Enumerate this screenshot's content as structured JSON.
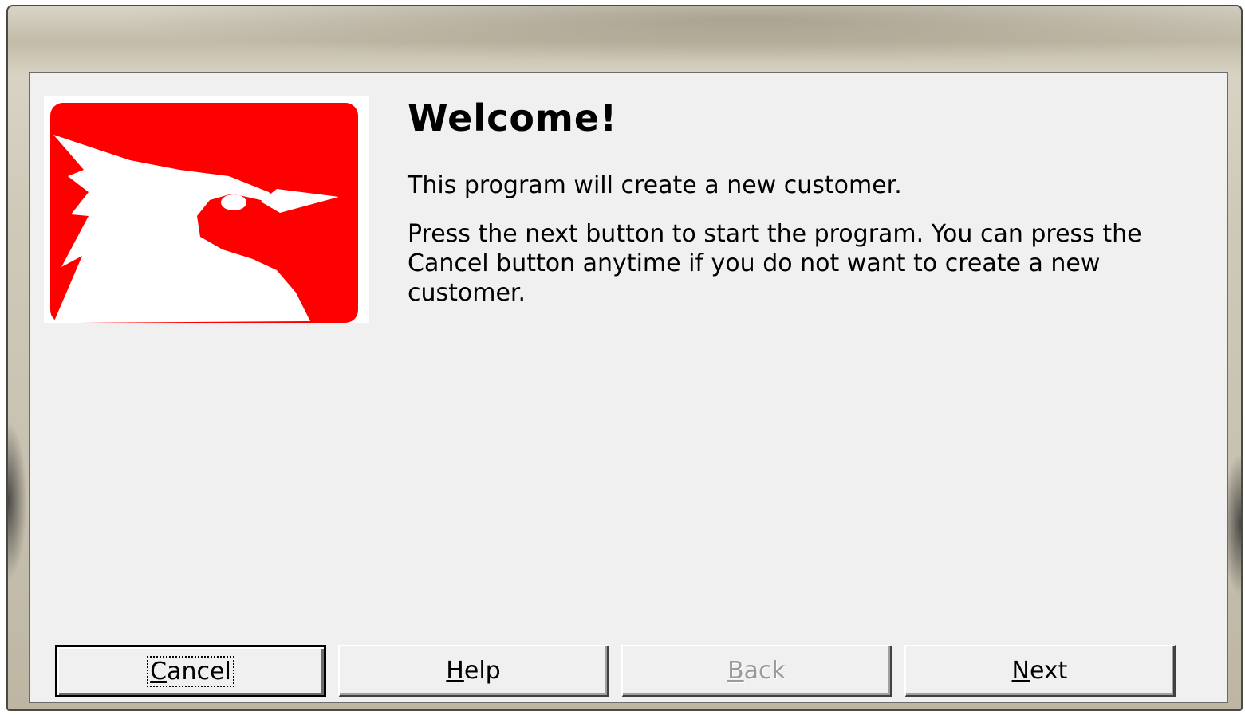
{
  "dialog": {
    "title": "Welcome!",
    "paragraphs": [
      "This program will create a new customer.",
      "Press the next button to start the program.  You can press the Cancel button anytime if you do not want to create a new customer."
    ],
    "logo_icon": "cardinal-bird-logo",
    "logo_color": "#ff0000"
  },
  "buttons": {
    "cancel": {
      "mnemonic": "C",
      "rest": "ancel",
      "state": "default-focused"
    },
    "help": {
      "mnemonic": "H",
      "rest": "elp",
      "state": "enabled"
    },
    "back": {
      "mnemonic": "B",
      "rest": "ack",
      "state": "disabled"
    },
    "next": {
      "mnemonic": "N",
      "rest": "ext",
      "state": "enabled"
    }
  }
}
